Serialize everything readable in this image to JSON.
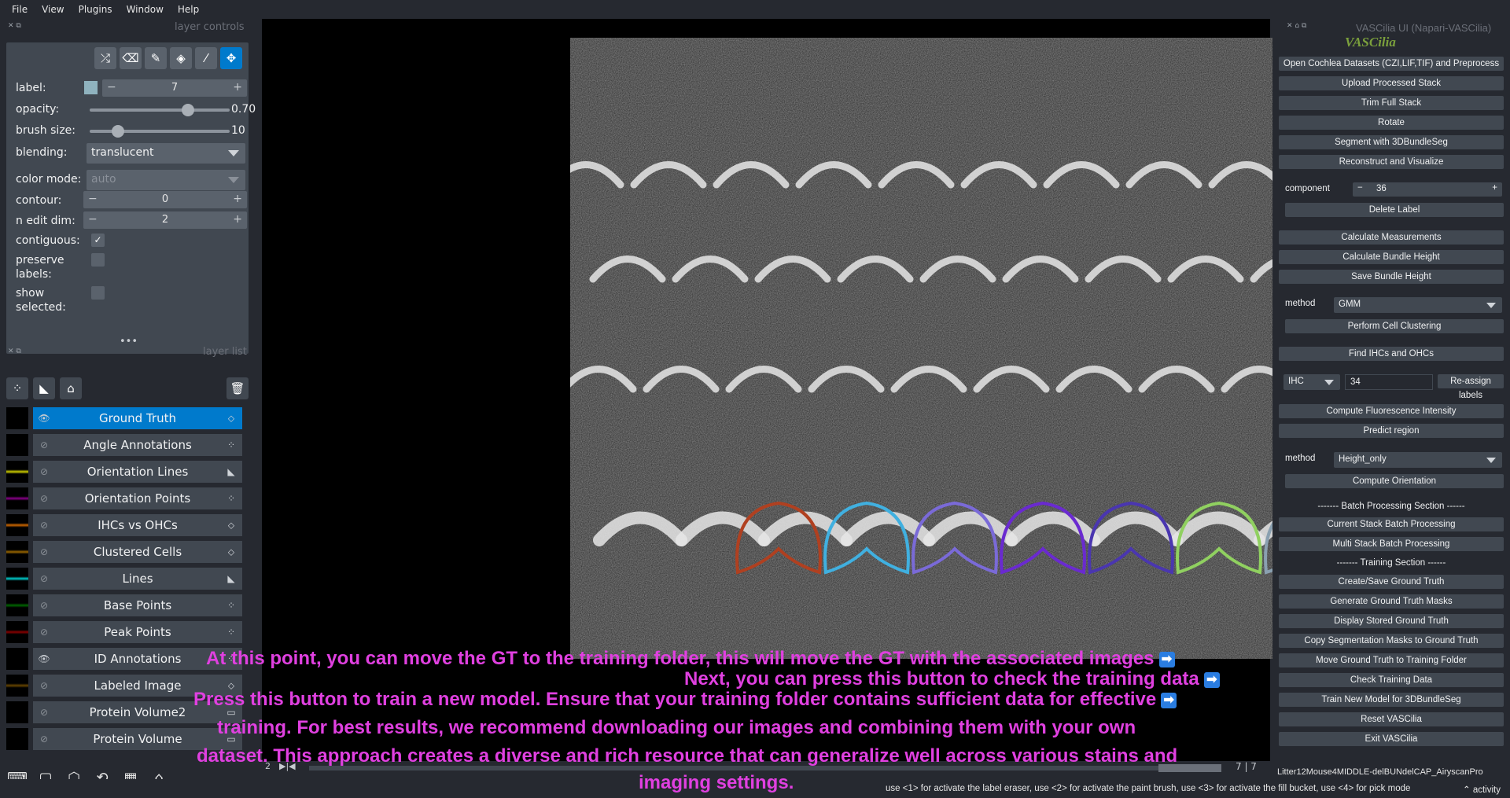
{
  "menu": [
    "File",
    "View",
    "Plugins",
    "Window",
    "Help"
  ],
  "layer_controls": {
    "title": "layer controls",
    "label_text": "label:",
    "label_value": "7",
    "opacity_text": "opacity:",
    "opacity_value": "0.70",
    "opacity_level": 0.7,
    "brush_text": "brush size:",
    "brush_value": "10",
    "brush_level": 0.2,
    "blending_text": "blending:",
    "blending_value": "translucent",
    "color_mode_text": "color mode:",
    "color_mode_value": "auto",
    "contour_text": "contour:",
    "contour_value": "0",
    "n_edit_text": "n edit dim:",
    "n_edit_value": "2",
    "contiguous_text": "contiguous:",
    "contiguous_checked": true,
    "preserve_text_1": "preserve",
    "preserve_text_2": "labels:",
    "show_text_1": "show",
    "show_text_2": "selected:"
  },
  "layer_list": {
    "title": "layer list",
    "layers": [
      {
        "name": "Ground Truth",
        "type": "label",
        "selected": true,
        "visible": true
      },
      {
        "name": "Angle Annotations",
        "type": "points",
        "visible": false
      },
      {
        "name": "Orientation Lines",
        "type": "shapes",
        "visible": false
      },
      {
        "name": "Orientation Points",
        "type": "points",
        "visible": false
      },
      {
        "name": "IHCs vs OHCs",
        "type": "label",
        "visible": false
      },
      {
        "name": "Clustered Cells",
        "type": "label",
        "visible": false
      },
      {
        "name": "Lines",
        "type": "shapes",
        "visible": false
      },
      {
        "name": "Base Points",
        "type": "points",
        "visible": false
      },
      {
        "name": "Peak Points",
        "type": "points",
        "visible": false
      },
      {
        "name": "ID Annotations",
        "type": "points",
        "visible": true
      },
      {
        "name": "Labeled Image",
        "type": "label",
        "visible": false
      },
      {
        "name": "Protein Volume2",
        "type": "image",
        "visible": false
      },
      {
        "name": "Protein Volume",
        "type": "image",
        "visible": false
      }
    ]
  },
  "right_panel": {
    "title": "VASCilia UI (Napari-VASCilia)",
    "logo": "VASCilia",
    "buttons_top": [
      "Open Cochlea Datasets (CZI,LIF,TIF) and Preprocess",
      "Upload Processed Stack",
      "Trim Full Stack",
      "Rotate",
      "Segment with 3DBundleSeg",
      "Reconstruct and Visualize"
    ],
    "component_label": "component",
    "component_value": "36",
    "delete_label": "Delete Label",
    "buttons_mid": [
      "Calculate Measurements",
      "Calculate Bundle Height",
      "Save Bundle Height"
    ],
    "method_label": "method",
    "method_value": "GMM",
    "perform_cluster": "Perform Cell Clustering",
    "find_ihc": "Find IHCs and OHCs",
    "ihc_select": "IHC",
    "ihc_value": "34",
    "reassign": "Re-assign labels",
    "compute_fluor": "Compute Fluorescence Intensity",
    "predict_region": "Predict region",
    "method2_label": "method",
    "method2_value": "Height_only",
    "compute_orientation": "Compute Orientation",
    "batch_section": "------- Batch Processing Section ------",
    "batch_buttons": [
      "Current Stack Batch Processing",
      "Multi Stack Batch Processing"
    ],
    "training_section": "------- Training Section ------",
    "training_buttons": [
      "Create/Save Ground Truth",
      "Generate Ground Truth Masks",
      "Display Stored Ground Truth",
      "Copy Segmentation Masks to Ground Truth",
      "Move Ground Truth to Training Folder",
      "Check Training Data",
      "Train New Model for 3DBundleSeg",
      "Reset VASCilia",
      "Exit VASCilia"
    ]
  },
  "slider": {
    "frame": "2",
    "count": "7 | 7"
  },
  "filename": "Litter12Mouse4MIDDLE-delBUNdelCAP_AiryscanPro",
  "status_text": "use <1> for activate the label eraser, use <2> for activate the paint brush, use <3> for activate the fill bucket, use <4> for pick mode",
  "activity": "activity",
  "overlay": {
    "line1": "At this point, you can move the GT to the training folder, this will move the GT with the associated images",
    "line2": "Next, you can press this button to check the training data",
    "line3": "Press this button to train a new model. Ensure that your training folder contains sufficient data for effective",
    "line4": "training. For best results, we recommend downloading our images and combining them with your own",
    "line5": "dataset. This approach creates a diverse and rich resource that can generalize well across various stains and",
    "line6": "imaging settings."
  },
  "colors": {
    "accent": "#007acc",
    "overlay_text": "#e040e0",
    "panel": "#414851",
    "background": "#262930"
  }
}
